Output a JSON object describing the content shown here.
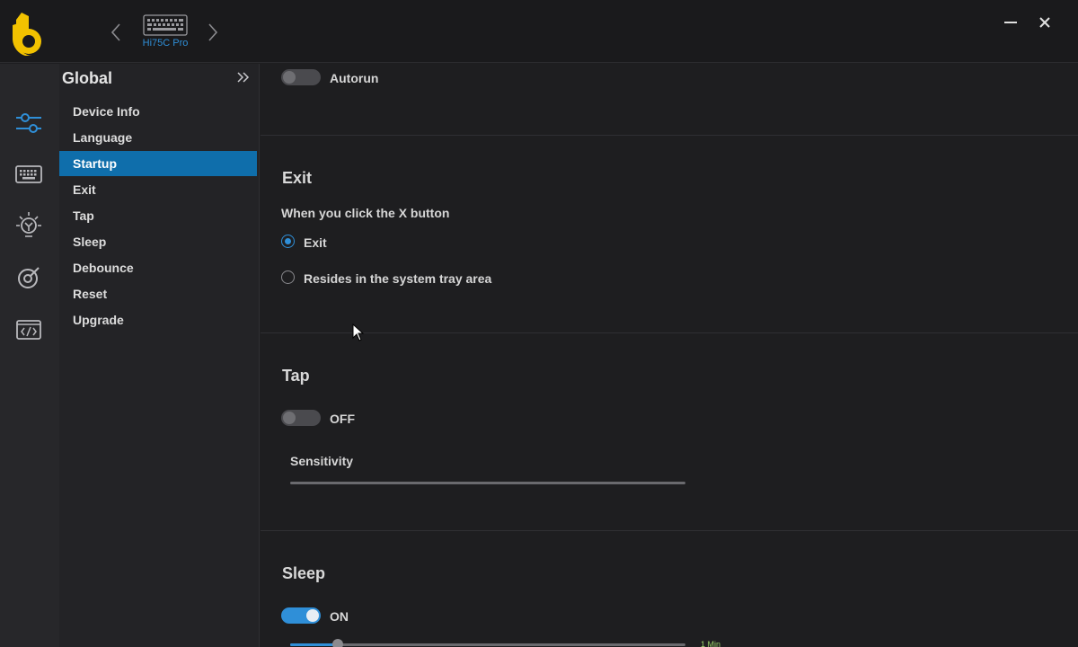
{
  "titlebar": {
    "device_name": "Hi75C Pro"
  },
  "rail": {
    "items": [
      {
        "icon": "sliders-icon",
        "active": true
      },
      {
        "icon": "keyboard-icon",
        "active": false
      },
      {
        "icon": "lightbulb-icon",
        "active": false
      },
      {
        "icon": "target-icon",
        "active": false
      },
      {
        "icon": "code-window-icon",
        "active": false
      }
    ]
  },
  "menu": {
    "title": "Global",
    "items": [
      {
        "label": "Device Info"
      },
      {
        "label": "Language"
      },
      {
        "label": "Startup",
        "active": true
      },
      {
        "label": "Exit"
      },
      {
        "label": "Tap"
      },
      {
        "label": "Sleep"
      },
      {
        "label": "Debounce"
      },
      {
        "label": "Reset"
      },
      {
        "label": "Upgrade"
      }
    ]
  },
  "startup": {
    "autorun_label": "Autorun",
    "autorun_on": false
  },
  "exit": {
    "title": "Exit",
    "prompt": "When you click the X button",
    "options": [
      {
        "label": "Exit",
        "checked": true
      },
      {
        "label": "Resides in the system tray area",
        "checked": false
      }
    ]
  },
  "tap": {
    "title": "Tap",
    "state_label": "OFF",
    "on": false,
    "sensitivity_label": "Sensitivity"
  },
  "sleep": {
    "title": "Sleep",
    "state_label": "ON",
    "on": true,
    "slider_value_label": "1 Min",
    "slider_fraction": 0.12
  },
  "colors": {
    "accent": "#2f8fd8",
    "active_menu": "#0f6eab",
    "logo_yellow": "#f2c200"
  }
}
